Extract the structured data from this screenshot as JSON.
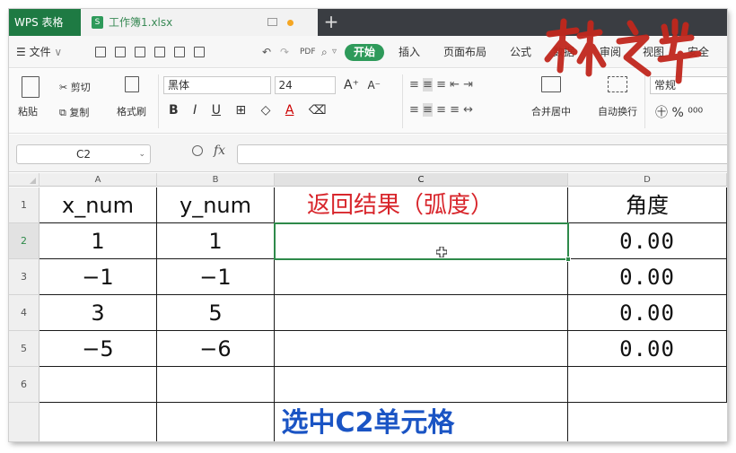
{
  "titlebar": {
    "app_label": "WPS 表格",
    "file_name": "工作簿1.xlsx",
    "file_icon": "S",
    "new_tab": "+"
  },
  "menubar": {
    "file_menu": "文件",
    "items": [
      "开始",
      "插入",
      "页面布局",
      "公式",
      "数据",
      "审阅",
      "视图",
      "安全"
    ]
  },
  "ribbon": {
    "paste": "粘贴",
    "cut": "剪切",
    "copy": "复制",
    "format_painter": "格式刷",
    "font_name": "黑体",
    "font_size": "24",
    "bold": "B",
    "italic": "I",
    "underline": "U",
    "font_color": "A",
    "grow_font": "A⁺",
    "shrink_font": "A⁻",
    "merge_center": "合并居中",
    "wrap_text": "自动换行",
    "number_format": "常规",
    "percent": "%"
  },
  "formula_bar": {
    "cell_ref": "C2",
    "fx": "fx",
    "content": ""
  },
  "grid": {
    "columns": [
      "A",
      "B",
      "C",
      "D"
    ],
    "rows": [
      "1",
      "2",
      "3",
      "4",
      "5",
      "6"
    ],
    "cells": [
      [
        "x_num",
        "y_num",
        "返回结果（弧度）",
        "角度"
      ],
      [
        "1",
        "1",
        "",
        "0.00"
      ],
      [
        "−1",
        "−1",
        "",
        "0.00"
      ],
      [
        "3",
        "5",
        "",
        "0.00"
      ],
      [
        "−5",
        "−6",
        "",
        "0.00"
      ],
      [
        "",
        "",
        "",
        ""
      ]
    ],
    "selected_cell": "C2"
  },
  "caption": "选中C2单元格",
  "watermark": "林之岸",
  "colors": {
    "accent": "#2e9a5a",
    "header_red": "#d8262c",
    "caption_blue": "#1a54c4",
    "watermark": "#c1271d"
  }
}
